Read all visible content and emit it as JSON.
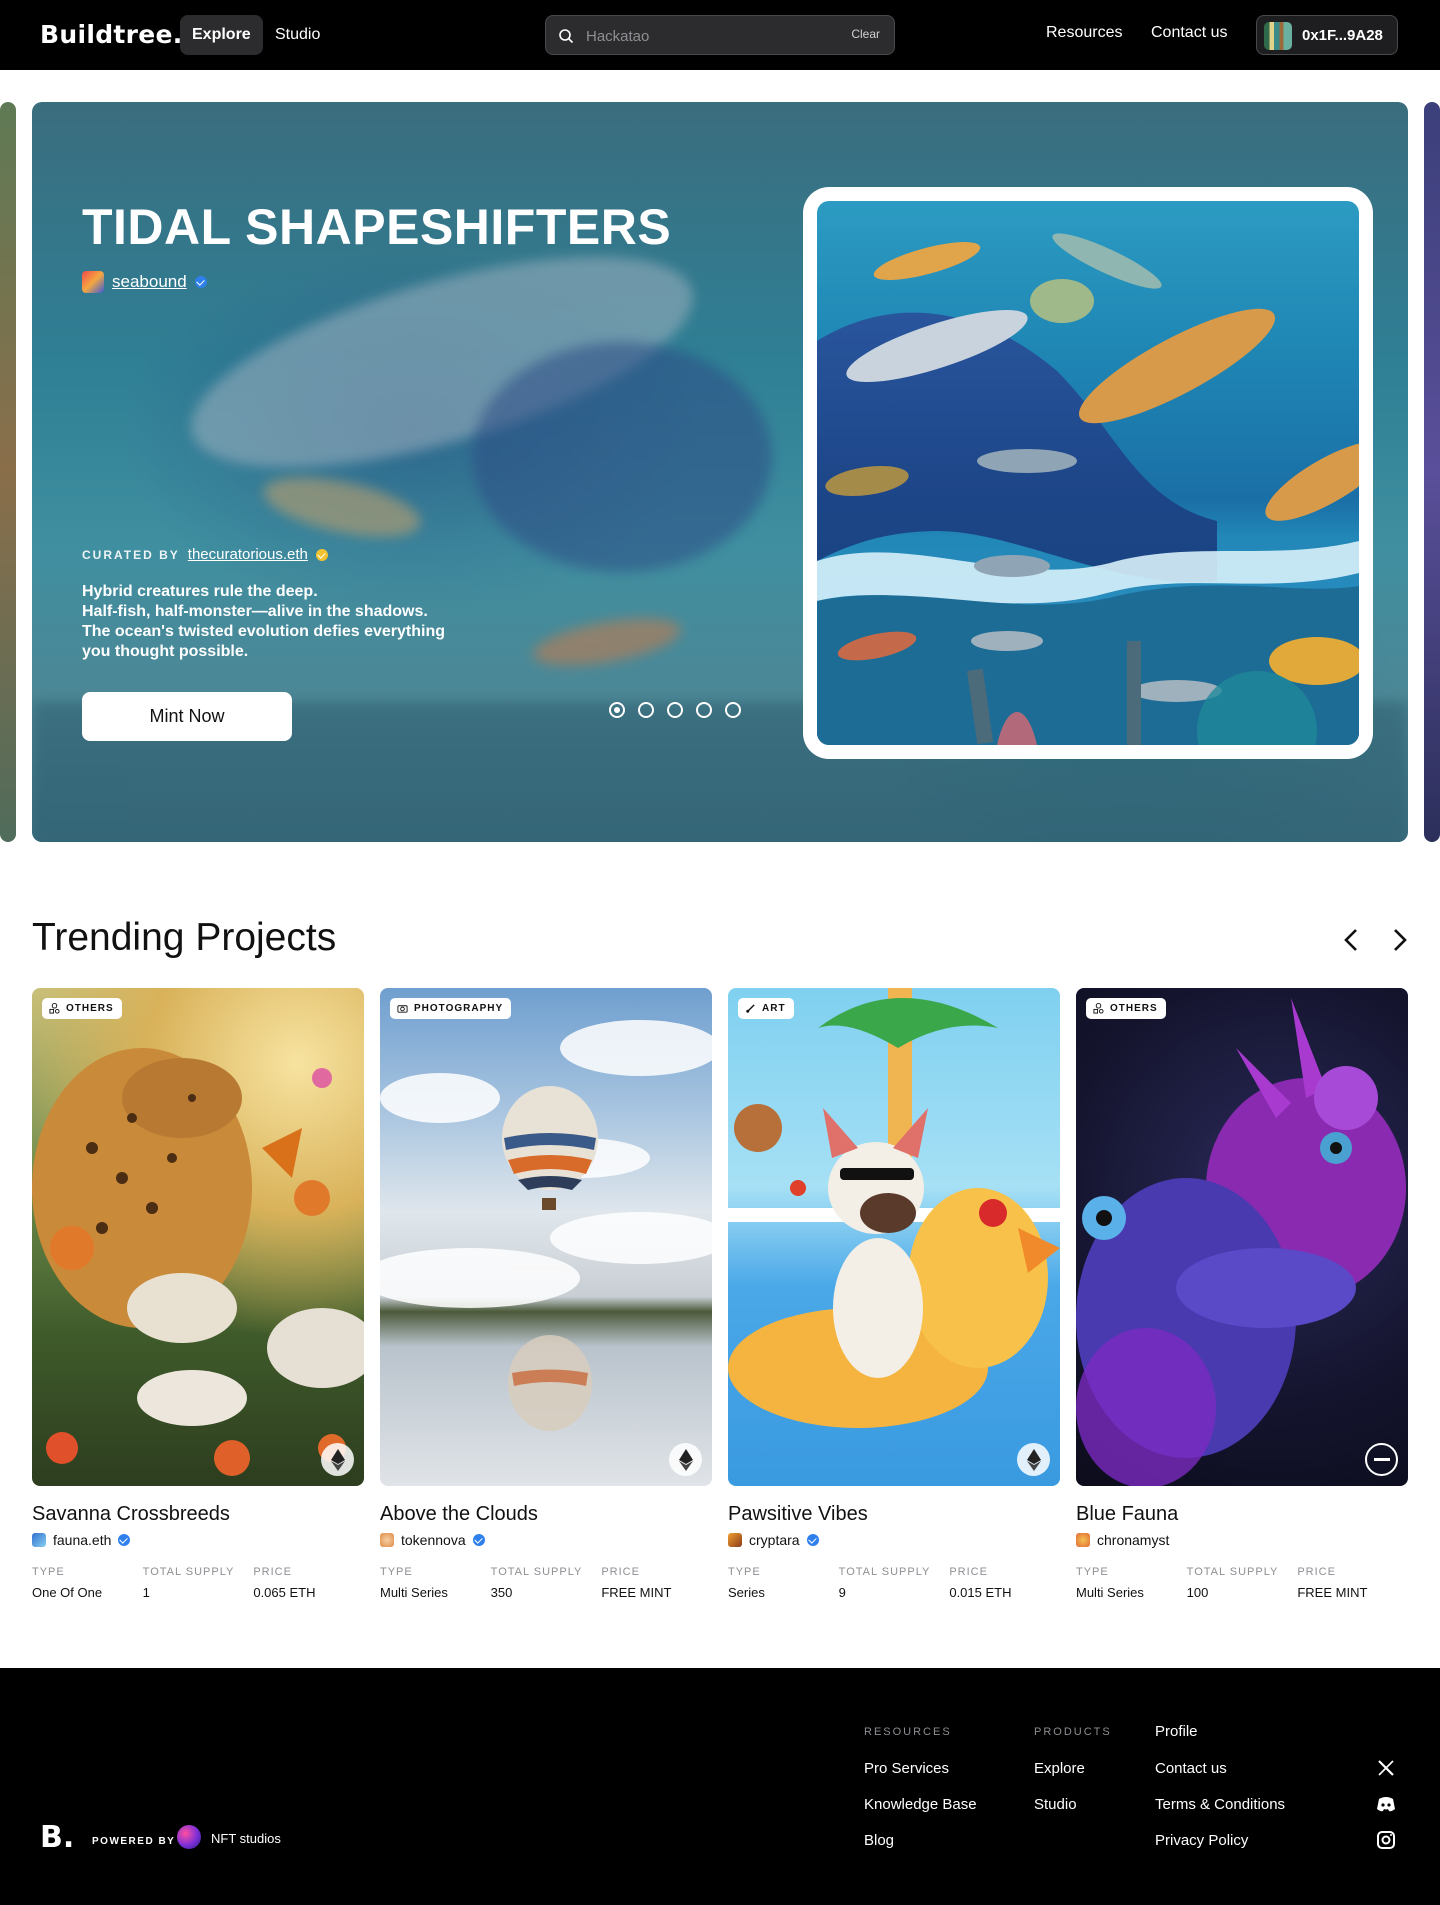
{
  "header": {
    "logo": "Buildtree.",
    "tabs": [
      {
        "label": "Explore",
        "active": true
      },
      {
        "label": "Studio",
        "active": false
      }
    ],
    "search": {
      "placeholder": "Hackatao",
      "clear_label": "Clear"
    },
    "links": [
      "Resources",
      "Contact us"
    ],
    "wallet": {
      "address": "0x1F...9A28"
    }
  },
  "hero": {
    "title": "TIDAL SHAPESHIFTERS",
    "creator": "seabound",
    "curated_label": "CURATED BY",
    "curator": "thecuratorious.eth",
    "description": [
      "Hybrid creatures rule the deep.",
      "Half-fish, half-monster—alive in the shadows.",
      "The ocean's twisted evolution defies everything",
      "you thought possible."
    ],
    "cta": "Mint Now",
    "slides": 5,
    "active_slide": 1
  },
  "trending": {
    "title": "Trending Projects",
    "meta_labels": {
      "type": "TYPE",
      "supply": "TOTAL SUPPLY",
      "price": "PRICE"
    },
    "cards": [
      {
        "tag": "OTHERS",
        "title": "Savanna Crossbreeds",
        "creator": "fauna.eth",
        "type": "One Of One",
        "supply": "1",
        "price": "0.065 ETH",
        "chain_icon": "ethereum-icon"
      },
      {
        "tag": "PHOTOGRAPHY",
        "title": "Above the Clouds",
        "creator": "tokennova",
        "type": "Multi Series",
        "supply": "350",
        "price": "FREE MINT",
        "chain_icon": "ethereum-icon"
      },
      {
        "tag": "ART",
        "title": "Pawsitive Vibes",
        "creator": "cryptara",
        "type": "Series",
        "supply": "9",
        "price": "0.015 ETH",
        "chain_icon": "ethereum-icon"
      },
      {
        "tag": "OTHERS",
        "title": "Blue Fauna",
        "creator": "chronamyst",
        "type": "Multi Series",
        "supply": "100",
        "price": "FREE MINT",
        "chain_icon": "other-chain-icon"
      }
    ]
  },
  "footer": {
    "logo": "B.",
    "powered_by": "POWERED BY",
    "partner": "NFT studios",
    "resources_heading": "RESOURCES",
    "resources": [
      "Pro Services",
      "Knowledge Base",
      "Blog"
    ],
    "products_heading": "PRODUCTS",
    "products": [
      "Explore",
      "Studio"
    ],
    "misc": [
      "Profile",
      "Contact us",
      "Terms & Conditions",
      "Privacy Policy"
    ],
    "social_icons": [
      "x-icon",
      "discord-icon",
      "instagram-icon"
    ]
  },
  "colors": {
    "header_bg": "#000000",
    "verified_blue": "#2f80ed",
    "curator_gold": "#f2c230"
  }
}
